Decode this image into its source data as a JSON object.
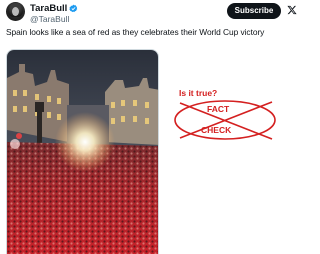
{
  "tweet": {
    "author_name": "TaraBull",
    "author_handle": "@TaraBull",
    "subscribe_label": "Subscribe",
    "text": "Spain looks like a sea of red as they celebrates their World Cup victory"
  },
  "annotation": {
    "question": "Is it true?",
    "stamp_top": "FACT",
    "stamp_bottom": "CHECK"
  },
  "colors": {
    "verified": "#1d9bf0",
    "stamp_red": "#d42020",
    "button_bg": "#0f1419"
  },
  "icons": [
    "verified-badge-icon",
    "x-logo-icon"
  ]
}
